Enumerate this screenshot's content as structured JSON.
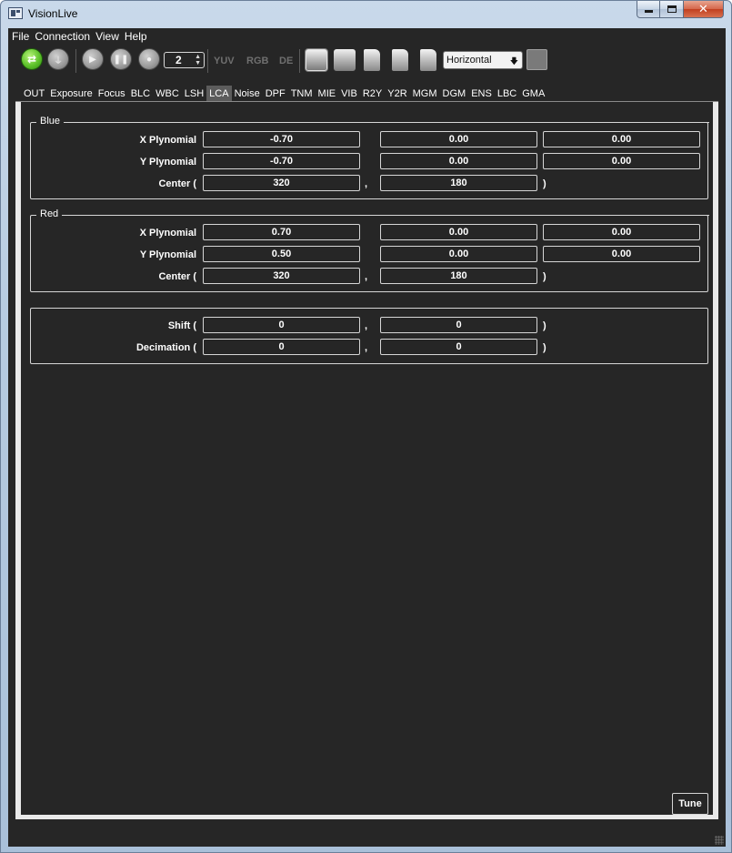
{
  "window": {
    "title": "VisionLive"
  },
  "menu": [
    "File",
    "Connection",
    "View",
    "Help"
  ],
  "toolbar": {
    "spin_value": "2",
    "format_labels": [
      "YUV",
      "RGB",
      "DE"
    ],
    "orientation": "Horizontal",
    "icons": {
      "connect": "swap-arrows-icon",
      "plug": "plug-icon",
      "play": "play-icon",
      "pause": "pause-icon",
      "record": "record-icon",
      "view_main": "image-view-icon",
      "view_alt": "camera-view-icon",
      "docs": [
        "document-icon",
        "document-icon",
        "document-icon"
      ],
      "disabled": "sad-face-icon"
    }
  },
  "tabs": [
    "OUT",
    "Exposure",
    "Focus",
    "BLC",
    "WBC",
    "LSH",
    "LCA",
    "Noise",
    "DPF",
    "TNM",
    "MIE",
    "VIB",
    "R2Y",
    "Y2R",
    "MGM",
    "DGM",
    "ENS",
    "LBC",
    "GMA"
  ],
  "active_tab": "LCA",
  "blue": {
    "title": "Blue",
    "x_label": "X Plynomial",
    "x": [
      "-0.70",
      "0.00",
      "0.00"
    ],
    "y_label": "Y Plynomial",
    "y": [
      "-0.70",
      "0.00",
      "0.00"
    ],
    "center_label": "Center (",
    "center": [
      "320",
      "180"
    ]
  },
  "red": {
    "title": "Red",
    "x_label": "X Plynomial",
    "x": [
      "0.70",
      "0.00",
      "0.00"
    ],
    "y_label": "Y Plynomial",
    "y": [
      "0.50",
      "0.00",
      "0.00"
    ],
    "center_label": "Center (",
    "center": [
      "320",
      "180"
    ]
  },
  "misc": {
    "shift_label": "Shift (",
    "shift": [
      "0",
      "0"
    ],
    "decimation_label": "Decimation (",
    "decimation": [
      "0",
      "0"
    ]
  },
  "punct": {
    "comma": ",",
    "close": ")"
  },
  "tune_label": "Tune"
}
